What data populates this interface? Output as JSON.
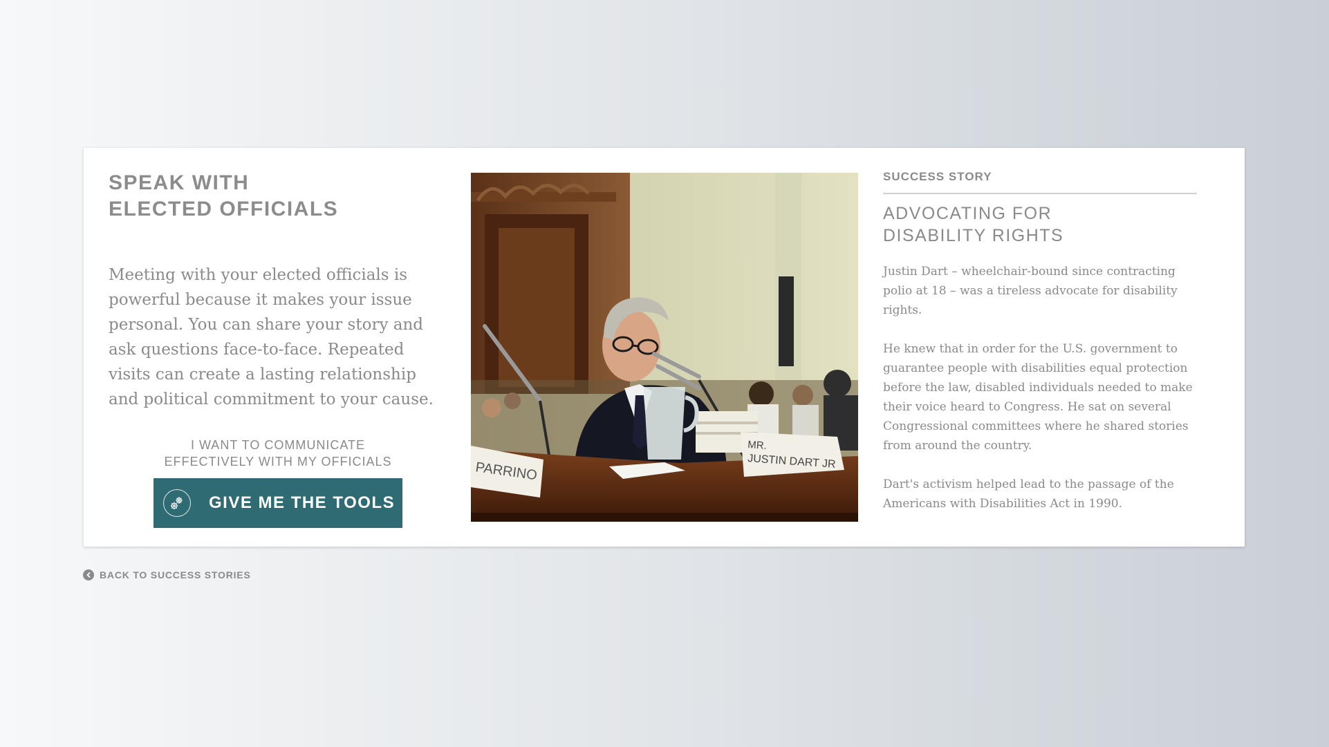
{
  "header": {
    "title_line1": "SPEAK WITH",
    "title_line2": "ELECTED OFFICIALS"
  },
  "intro": {
    "text": "Meeting with your elected officials is powerful because it makes your issue personal. You can share your story and ask questions face-to-face. Repeated visits can create a lasting relationship and political commitment to your cause."
  },
  "cta": {
    "caption_line1": "I WANT TO COMMUNICATE",
    "caption_line2": "EFFECTIVELY WITH MY OFFICIALS",
    "button_label": "GIVE ME THE TOOLS",
    "button_icon": "gears-icon",
    "button_color": "#2f6b72"
  },
  "photo": {
    "subject": "Justin Dart testifying at a congressional hearing",
    "nameplate_left": "PARRINO",
    "nameplate_right_line1": "MR.",
    "nameplate_right_line2": "JUSTIN DART JR"
  },
  "story": {
    "label": "SUCCESS STORY",
    "title_line1": "ADVOCATING FOR",
    "title_line2": "DISABILITY RIGHTS",
    "paragraphs": [
      "Justin Dart – wheelchair-bound since contracting polio at 18 – was a tireless advocate for disability rights.",
      "He knew that in order for the U.S. government to guarantee people with disabilities equal protection before the law, disabled individuals needed to make their voice heard to Congress. He sat on several Congressional committees where he shared stories from around the country.",
      "Dart's activism helped lead to the passage of the Americans with Disabilities Act in 1990."
    ]
  },
  "back_link": {
    "label": "BACK TO SUCCESS STORIES",
    "icon": "chevron-left-icon"
  }
}
